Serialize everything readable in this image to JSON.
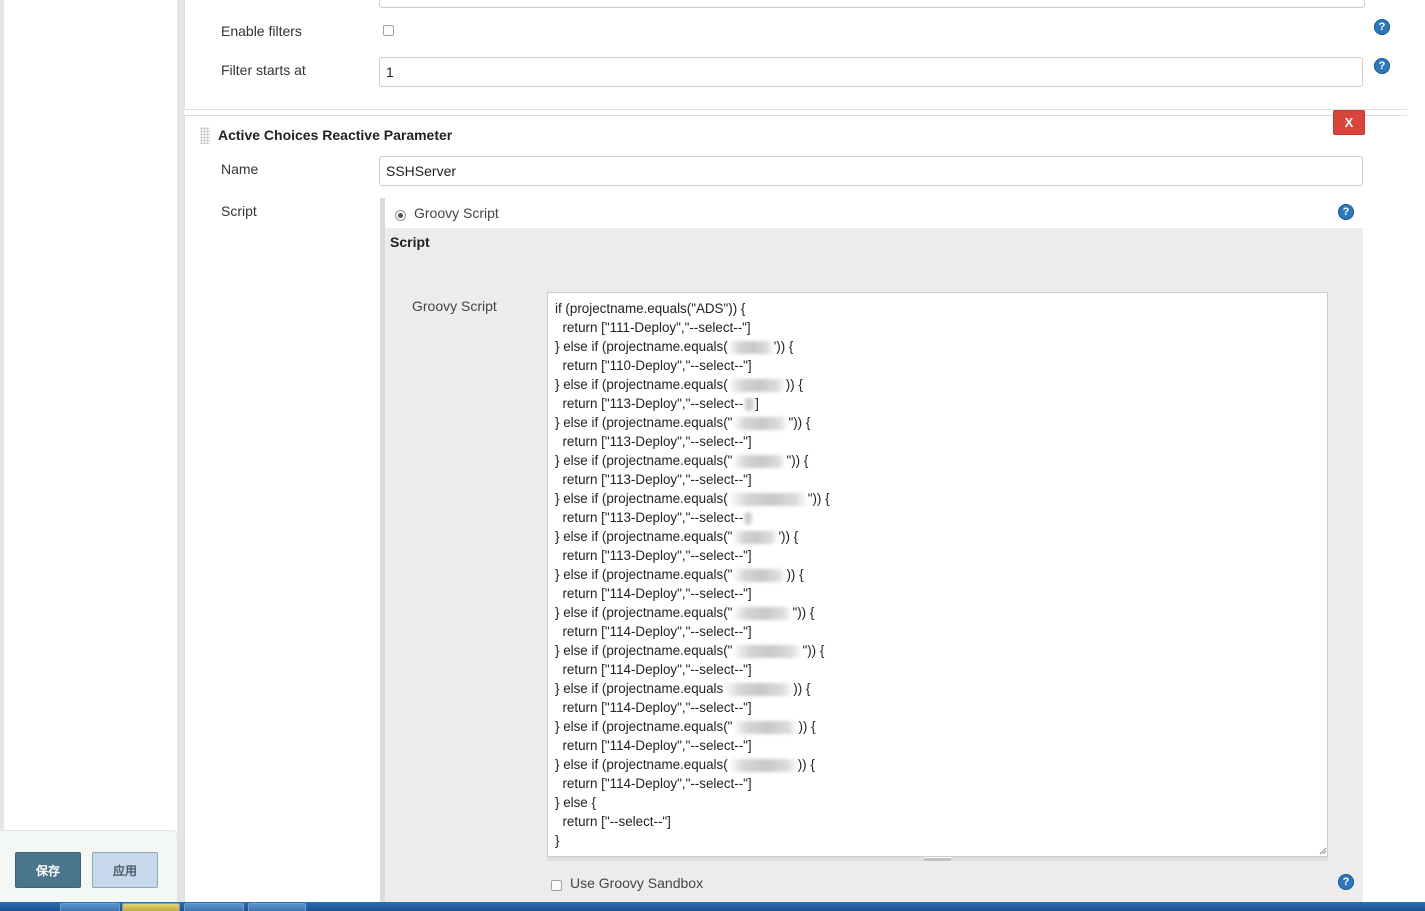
{
  "form": {
    "enable_filters_label": "Enable filters",
    "filter_starts_at_label": "Filter starts at",
    "filter_starts_at_value": "1"
  },
  "parameter": {
    "title": "Active Choices Reactive Parameter",
    "delete_label": "X",
    "name_label": "Name",
    "name_value": "SSHServer",
    "script_label": "Script",
    "groovy_script_radio_label": "Groovy Script",
    "script_section_title": "Script",
    "groovy_script_field_label": "Groovy Script",
    "use_sandbox_label": "Use Groovy Sandbox",
    "code_lines": [
      "if (projectname.equals(\"ADS\")) {",
      "  return [\"111-Deploy\",\"--select--\"]",
      "} else if (projectname.equals(",
      "  return [\"110-Deploy\",\"--select--\"]",
      "} else if (projectname.equals(",
      "  return [\"113-Deploy\",\"--select--",
      "} else if (projectname.equals(\"",
      "  return [\"113-Deploy\",\"--select--\"]",
      "} else if (projectname.equals(\"",
      "  return [\"113-Deploy\",\"--select--\"]",
      "} else if (projectname.equals(",
      "  return [\"113-Deploy\",\"--select--",
      "} else if (projectname.equals(\"",
      "  return [\"113-Deploy\",\"--select--\"]",
      "} else if (projectname.equals(\"",
      "  return [\"114-Deploy\",\"--select--\"]",
      "} else if (projectname.equals(\"",
      "  return [\"114-Deploy\",\"--select--\"]",
      "} else if (projectname.equals(\"",
      "  return [\"114-Deploy\",\"--select--\"]",
      "} else if (projectname.equals",
      "  return [\"114-Deploy\",\"--select--\"]",
      "} else if (projectname.equals(\"",
      "  return [\"114-Deploy\",\"--select--\"]",
      "} else if (projectname.equals(",
      "  return [\"114-Deploy\",\"--select--\"]",
      "} else {",
      "  return [\"--select--\"]",
      "}"
    ],
    "code_line_tails": [
      "",
      "",
      "')) {",
      "",
      ")) {",
      "]",
      "\")) {",
      "",
      "\")) {",
      "",
      "\")) {",
      "",
      "')) {",
      "",
      ")) {",
      "",
      "\")) {",
      "",
      "\")) {",
      "",
      ")) {",
      "",
      ")) {",
      "",
      ")) {",
      "",
      "",
      "",
      ""
    ]
  },
  "footer": {
    "save_label": "保存",
    "apply_label": "应用"
  },
  "colors": {
    "save_button": "#4b758b",
    "apply_button": "#c5d9ea",
    "delete_button": "#d9443c",
    "help_icon": "#2e78b8"
  }
}
